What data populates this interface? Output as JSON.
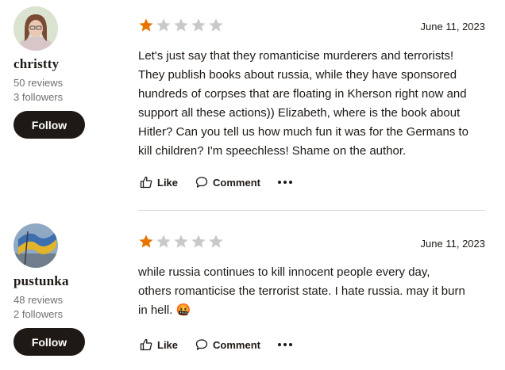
{
  "reviews": [
    {
      "user": {
        "name": "christty",
        "reviews": "50 reviews",
        "followers": "3 followers",
        "follow_label": "Follow"
      },
      "rating": 1,
      "max_rating": 5,
      "date": "June 11, 2023",
      "text": "Let's just say that they romanticise murderers and terrorists!\nThey publish books about russia, while they have sponsored\nhundreds of corpses that are floating in Kherson right now and\nsupport all these actions)) Elizabeth, where is the book about\nHitler? Can you tell us how much fun it was for the Germans to\nkill children? I'm speechless! Shame on the author.",
      "actions": {
        "like": "Like",
        "comment": "Comment"
      }
    },
    {
      "user": {
        "name": "pustunka",
        "reviews": "48 reviews",
        "followers": "2 followers",
        "follow_label": "Follow"
      },
      "rating": 1,
      "max_rating": 5,
      "date": "June 11, 2023",
      "text": "while russia continues to kill innocent people every day,\nothers romanticise the terrorist state. I hate russia. may it burn\nin hell. 🤬",
      "actions": {
        "like": "Like",
        "comment": "Comment"
      }
    }
  ],
  "colors": {
    "star_filled": "#e87400",
    "star_empty": "#c9c9c9",
    "button_bg": "#1e1915"
  },
  "icons": {
    "like": "thumbs-up-icon",
    "comment": "speech-bubble-icon",
    "more": "more-dots-icon"
  }
}
